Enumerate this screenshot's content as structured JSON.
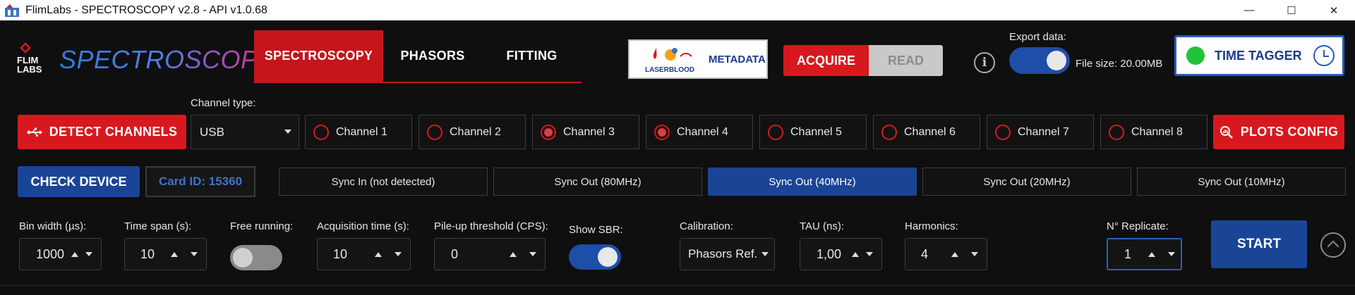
{
  "window": {
    "title": "FlimLabs - SPECTROSCOPY v2.8 - API v1.0.68",
    "minimize": "—",
    "maximize": "☐",
    "close": "✕"
  },
  "header": {
    "logo_text": "FLIM LABS",
    "brand": "SPECTROSCOPY",
    "tabs": [
      {
        "label": "SPECTROSCOPY",
        "active": true
      },
      {
        "label": "PHASORS",
        "active": false
      },
      {
        "label": "FITTING",
        "active": false
      }
    ],
    "metadata": {
      "label": "METADATA",
      "logo_text": "LASERBLOOD"
    },
    "acquire_label": "ACQUIRE",
    "read_label": "READ",
    "info_icon": "i",
    "export_label": "Export data:",
    "export_enabled": true,
    "file_size": "File size: 20.00MB",
    "time_tagger_label": "TIME TAGGER",
    "time_tagger_status_color": "#21c33a"
  },
  "channels": {
    "detect_label": "DETECT CHANNELS",
    "type_label": "Channel type:",
    "type_value": "USB",
    "items": [
      {
        "label": "Channel 1",
        "checked": false
      },
      {
        "label": "Channel 2",
        "checked": false
      },
      {
        "label": "Channel 3",
        "checked": true
      },
      {
        "label": "Channel 4",
        "checked": true
      },
      {
        "label": "Channel 5",
        "checked": false
      },
      {
        "label": "Channel 6",
        "checked": false
      },
      {
        "label": "Channel 7",
        "checked": false
      },
      {
        "label": "Channel 8",
        "checked": false
      }
    ],
    "plots_config_label": "PLOTS CONFIG"
  },
  "device": {
    "check_label": "CHECK DEVICE",
    "card_id": "Card ID: 15360",
    "sync": [
      {
        "label": "Sync In (not detected)",
        "active": false
      },
      {
        "label": "Sync Out (80MHz)",
        "active": false
      },
      {
        "label": "Sync Out (40MHz)",
        "active": true
      },
      {
        "label": "Sync Out (20MHz)",
        "active": false
      },
      {
        "label": "Sync Out (10MHz)",
        "active": false
      }
    ]
  },
  "controls": {
    "bin_width": {
      "label": "Bin width (µs):",
      "value": "1000"
    },
    "time_span": {
      "label": "Time span (s):",
      "value": "10"
    },
    "free_running": {
      "label": "Free running:",
      "enabled": false
    },
    "acquisition_time": {
      "label": "Acquisition time (s):",
      "value": "10"
    },
    "pileup": {
      "label": "Pile-up threshold (CPS):",
      "value": "0"
    },
    "show_sbr": {
      "label": "Show SBR:",
      "enabled": true
    },
    "calibration": {
      "label": "Calibration:",
      "value": "Phasors Ref."
    },
    "tau": {
      "label": "TAU (ns):",
      "value": "1,00"
    },
    "harmonics": {
      "label": "Harmonics:",
      "value": "4"
    },
    "replicate": {
      "label": "N° Replicate:",
      "value": "1"
    },
    "start_label": "START"
  },
  "colors": {
    "accent_red": "#d8181f",
    "accent_blue": "#1a4596",
    "background": "#0f0f10"
  }
}
